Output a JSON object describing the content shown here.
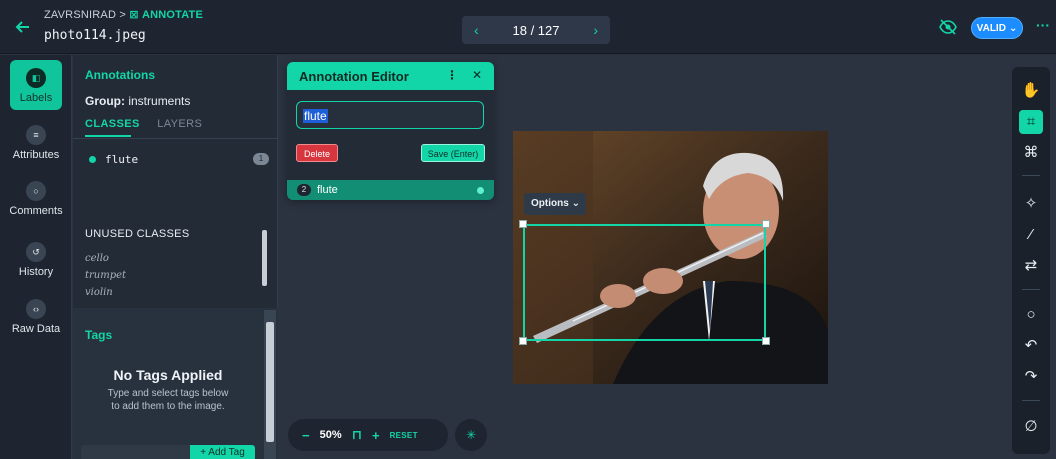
{
  "header": {
    "breadcrumb_root": "ZAVRSNIRAD",
    "breadcrumb_sep": ">",
    "breadcrumb_current": "ANNOTATE",
    "filename": "photo114.jpeg",
    "pager_count": "18 / 127",
    "pager_prev": "‹",
    "pager_next": "›",
    "status_label": "VALID",
    "status_color": "#1c8cff",
    "more_label": "···",
    "accent_color": "#12d6a8"
  },
  "rail": {
    "items": [
      {
        "label": "Labels",
        "icon": "tag-icon",
        "active": true
      },
      {
        "label": "Attributes",
        "icon": "list-icon"
      },
      {
        "label": "Comments",
        "icon": "comment-icon"
      },
      {
        "label": "History",
        "icon": "history-icon"
      },
      {
        "label": "Raw Data",
        "icon": "code-icon"
      }
    ]
  },
  "panel": {
    "title": "Annotations",
    "group_label": "Group:",
    "group_value": "instruments",
    "tabs": [
      "CLASSES",
      "LAYERS"
    ],
    "classes": [
      {
        "name": "flute",
        "count": "1"
      }
    ],
    "unused_title": "UNUSED CLASSES",
    "unused": [
      "cello",
      "trumpet",
      "violin"
    ],
    "tags_title": "Tags",
    "no_tags": "No Tags Applied",
    "no_tags_sub_1": "Type and select tags below",
    "no_tags_sub_2": "to add them to the image.",
    "add_tag_label": "+ Add Tag"
  },
  "editor": {
    "title": "Annotation Editor",
    "input_value": "flute",
    "delete_label": "Delete",
    "save_label": "Save (Enter)",
    "row_number": "2",
    "row_label": "flute"
  },
  "canvas": {
    "options_label": "Options"
  },
  "zoom": {
    "minus": "−",
    "level": "50%",
    "plus": "+",
    "reset_label": "RESET"
  },
  "toolbar": {
    "tools": [
      "hand-icon",
      "bbox-icon",
      "polygon-icon",
      "magic-icon",
      "wand-icon",
      "swap-icon",
      "comment-icon",
      "undo-icon",
      "redo-icon",
      "clear-icon"
    ]
  }
}
